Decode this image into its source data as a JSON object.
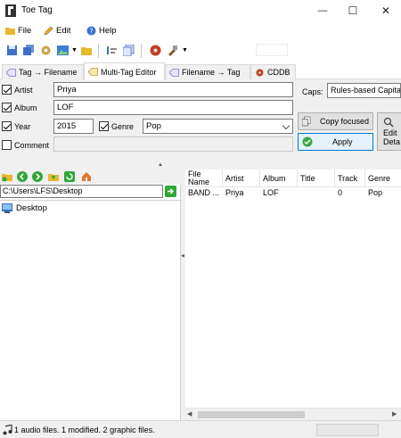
{
  "window": {
    "title": "Toe Tag",
    "minimize_glyph": "—",
    "maximize_glyph": "☐",
    "close_glyph": "✕"
  },
  "menu": {
    "items": [
      {
        "label": "File",
        "icon": "folder-icon"
      },
      {
        "label": "Edit",
        "icon": "pencil-icon"
      },
      {
        "label": "Help",
        "icon": "help-icon"
      }
    ]
  },
  "tabs": [
    {
      "label": "Tag → Filename",
      "icon": "tag-icon",
      "active": false
    },
    {
      "label": "Multi-Tag Editor",
      "icon": "tag-icon",
      "active": true
    },
    {
      "label": "Filename → Tag",
      "icon": "tag-icon",
      "active": false
    },
    {
      "label": "CDDB",
      "icon": "cd-icon",
      "active": false
    }
  ],
  "form": {
    "artist": {
      "label": "Artist",
      "value": "Priya",
      "checked": true
    },
    "album": {
      "label": "Album",
      "value": "LOF",
      "checked": true
    },
    "year": {
      "label": "Year",
      "value": "2015",
      "checked": true
    },
    "genre": {
      "label": "Genre",
      "value": "Pop",
      "checked": true
    },
    "comment": {
      "label": "Comment",
      "value": "",
      "checked": false
    },
    "caps_label": "Caps:",
    "caps_value": "Rules-based Capita",
    "copy_focused_label": "Copy focused",
    "apply_label": "Apply",
    "edit_details_label": "Edit Deta"
  },
  "left_pane": {
    "path": "C:\\Users\\LFS\\Desktop",
    "tree_item": "Desktop"
  },
  "file_list": {
    "columns": [
      "File Name",
      "Artist",
      "Album",
      "Title",
      "Track",
      "Genre"
    ],
    "rows": [
      {
        "file_name": "BAND ...",
        "artist": "Priya",
        "album": "LOF",
        "title": "",
        "track": "0",
        "genre": "Pop"
      }
    ]
  },
  "status": {
    "text": "1 audio files. 1 modified. 2 graphic files."
  }
}
